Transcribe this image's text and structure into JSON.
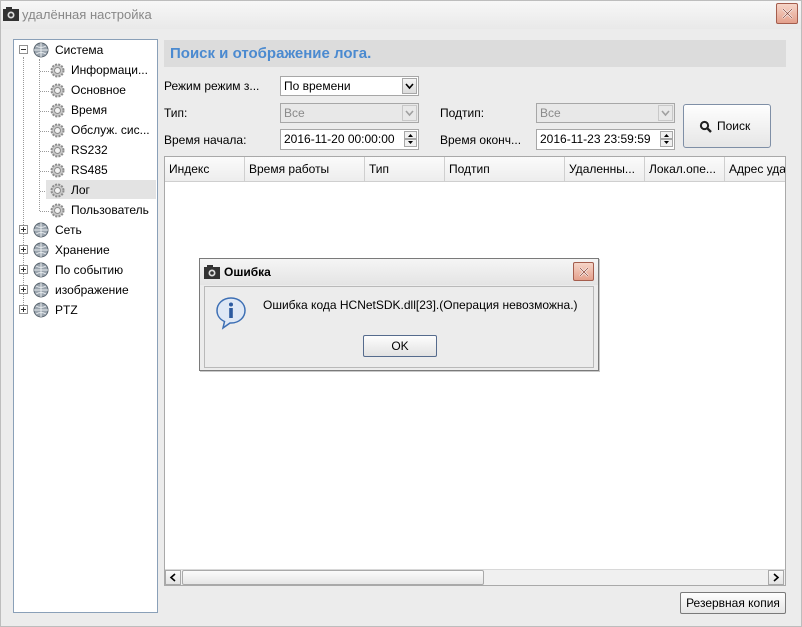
{
  "window": {
    "title": "удалённая настройка"
  },
  "tree": {
    "items": [
      {
        "label": "Система",
        "level": 0,
        "state": "expanded"
      },
      {
        "label": "Информаци...",
        "level": 1
      },
      {
        "label": "Основное",
        "level": 1
      },
      {
        "label": "Время",
        "level": 1
      },
      {
        "label": "Обслуж. сис...",
        "level": 1
      },
      {
        "label": "RS232",
        "level": 1
      },
      {
        "label": "RS485",
        "level": 1
      },
      {
        "label": "Лог",
        "level": 1,
        "selected": true
      },
      {
        "label": "Пользователь",
        "level": 1
      },
      {
        "label": "Сеть",
        "level": 0,
        "state": "collapsed"
      },
      {
        "label": "Хранение",
        "level": 0,
        "state": "collapsed"
      },
      {
        "label": "По событию",
        "level": 0,
        "state": "collapsed"
      },
      {
        "label": "изображение",
        "level": 0,
        "state": "collapsed"
      },
      {
        "label": "PTZ",
        "level": 0,
        "state": "collapsed"
      }
    ]
  },
  "main": {
    "title": "Поиск и отображение лога.",
    "mode_label": "Режим режим з...",
    "mode_value": "По времени",
    "type_label": "Тип:",
    "type_value": "Все",
    "subtype_label": "Подтип:",
    "subtype_value": "Все",
    "start_label": "Время начала:",
    "start_value": "2016-11-20 00:00:00",
    "end_label": "Время оконч...",
    "end_value": "2016-11-23 23:59:59",
    "search_label": "Поиск",
    "backup_label": "Резервная копия"
  },
  "table": {
    "columns": [
      "Индекс",
      "Время работы",
      "Тип",
      "Подтип",
      "Удаленны...",
      "Локал.опе...",
      "Адрес уда"
    ]
  },
  "dialog": {
    "title": "Ошибка",
    "message": "Ошибка кода HCNetSDK.dll[23].(Операция невозможна.)",
    "ok_label": "OK"
  },
  "colors": {
    "accent_title": "#4b8ad0",
    "close_button": "#e4a08c",
    "panel_background": "#ececec"
  }
}
